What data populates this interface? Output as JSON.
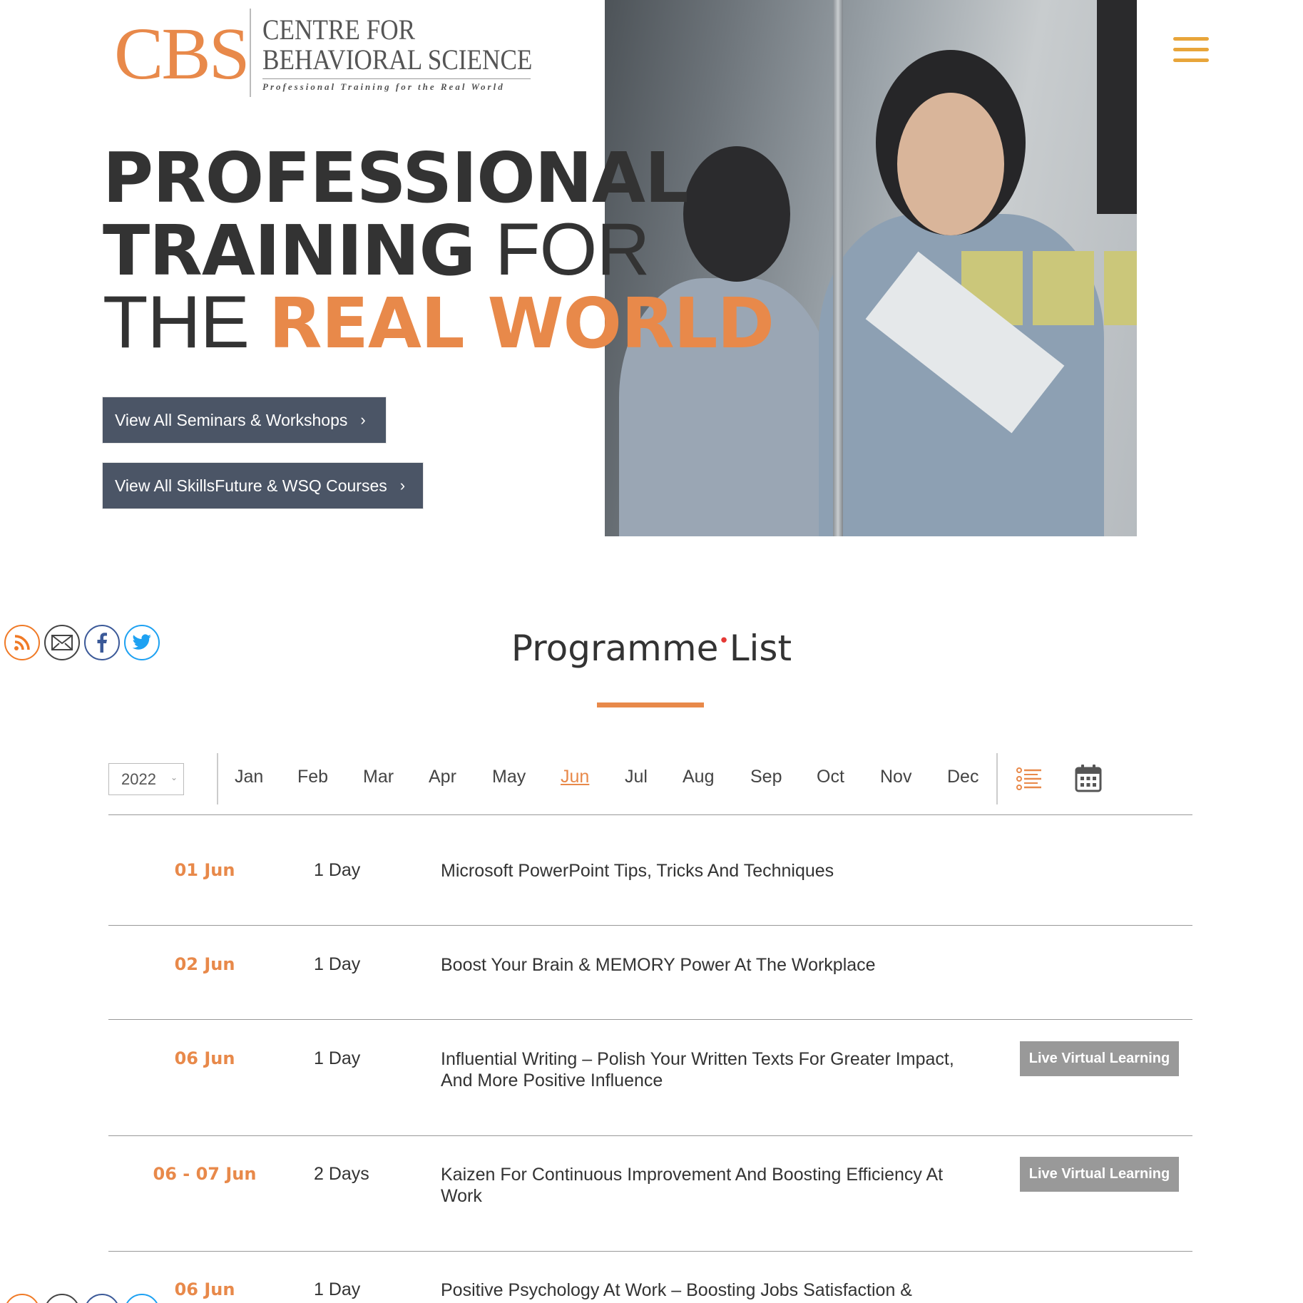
{
  "logo": {
    "abbr": "CBS",
    "line1": "CENTRE FOR",
    "line2": "BEHAVIORAL SCIENCE",
    "tagline": "Professional Training for the Real World"
  },
  "hero": {
    "h1_part1": "PROFESSIONAL",
    "h1_part2_bold": "TRAINING",
    "h1_part2_light": " FOR",
    "h1_part3_light": "THE ",
    "h1_part3_orange": "REAL WORLD",
    "cta1_label": "View All Seminars & Workshops",
    "cta2_label": "View All SkillsFuture & WSQ Courses",
    "cta_chevron": "›"
  },
  "social_icons": [
    "rss-icon",
    "mail-icon",
    "facebook-icon",
    "twitter-icon"
  ],
  "programme": {
    "title_part1": "Programme",
    "title_dot": "•",
    "title_part2": "List",
    "year": "2022",
    "months": [
      "Jan",
      "Feb",
      "Mar",
      "Apr",
      "May",
      "Jun",
      "Jul",
      "Aug",
      "Sep",
      "Oct",
      "Nov",
      "Dec"
    ],
    "active_month": "Jun",
    "rows": [
      {
        "date": "01 Jun",
        "duration": "1 Day",
        "name": "Microsoft PowerPoint Tips, Tricks And Techniques",
        "badge": ""
      },
      {
        "date": "02 Jun",
        "duration": "1 Day",
        "name": "Boost Your Brain & MEMORY Power At The Workplace",
        "badge": ""
      },
      {
        "date": "06 Jun",
        "duration": "1 Day",
        "name": "Influential Writing – Polish Your Written Texts For Greater Impact, And More Positive Influence",
        "badge": "Live Virtual Learning"
      },
      {
        "date": "06 - 07 Jun",
        "duration": "2 Days",
        "name": "Kaizen For Continuous Improvement And Boosting Efficiency At Work",
        "badge": "Live Virtual Learning"
      },
      {
        "date": "06 Jun",
        "duration": "1 Day",
        "name": "Positive Psychology At Work – Boosting Jobs Satisfaction &",
        "badge": ""
      }
    ]
  },
  "colors": {
    "accent": "#e8894a",
    "button": "#4b5566",
    "hamburger": "#e8a53a",
    "badge": "#999999"
  }
}
